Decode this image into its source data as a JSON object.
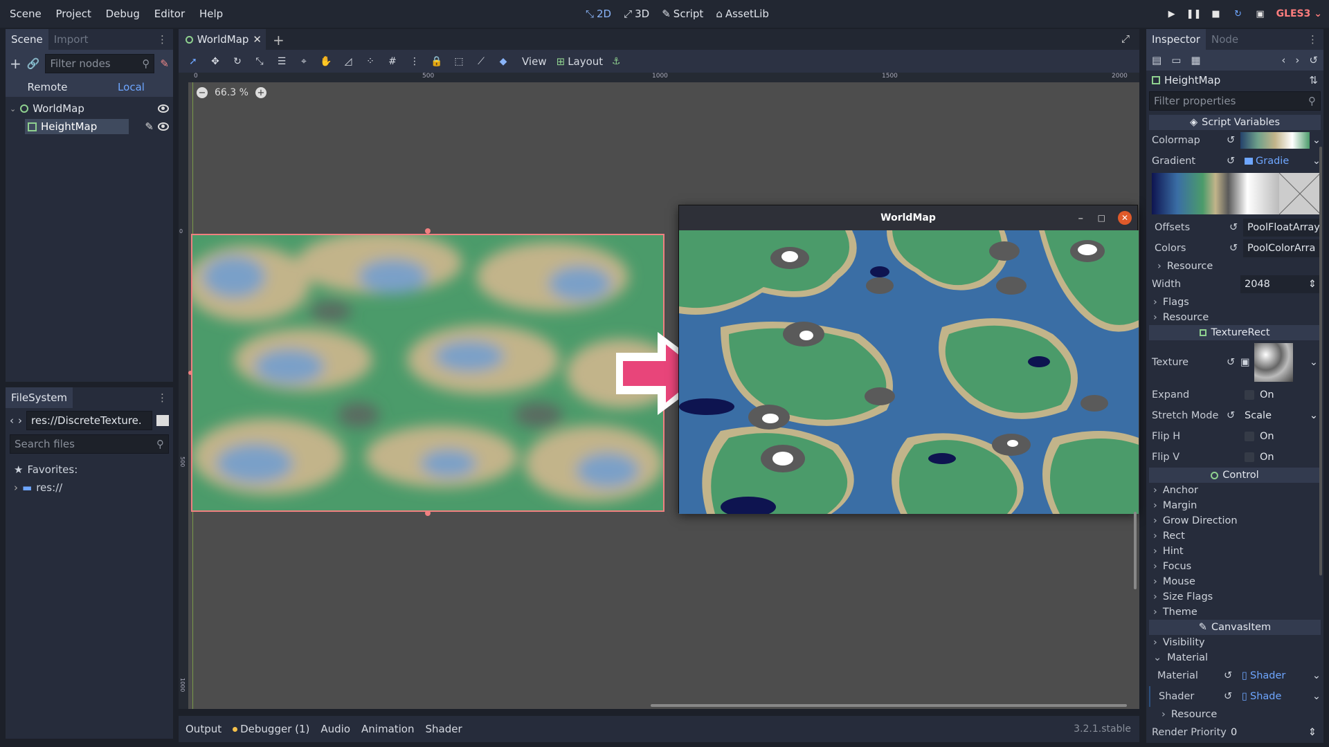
{
  "menu": [
    "Scene",
    "Project",
    "Debug",
    "Editor",
    "Help"
  ],
  "modes": [
    {
      "label": "2D",
      "active": true
    },
    {
      "label": "3D"
    },
    {
      "label": "Script"
    },
    {
      "label": "AssetLib"
    }
  ],
  "renderer": "GLES3",
  "scene_panel": {
    "tabs": [
      "Scene",
      "Import"
    ],
    "filter_placeholder": "Filter nodes",
    "remote_label": "Remote",
    "local_label": "Local",
    "tree": [
      {
        "name": "WorldMap"
      },
      {
        "name": "HeightMap"
      }
    ]
  },
  "filesystem_panel": {
    "tab": "FileSystem",
    "path": "res://DiscreteTexture.",
    "search_placeholder": "Search files",
    "favorites_label": "Favorites:",
    "res_label": "res://"
  },
  "editor": {
    "tab_label": "WorldMap",
    "zoom": "66.3 %",
    "view_label": "View",
    "layout_label": "Layout",
    "ruler_marks": [
      "0",
      "500",
      "1000",
      "1500",
      "2000"
    ],
    "ruler_v_marks": [
      "0",
      "500",
      "1000"
    ]
  },
  "game_window": {
    "title": "WorldMap"
  },
  "inspector": {
    "tabs": [
      "Inspector",
      "Node"
    ],
    "node_name": "HeightMap",
    "filter_placeholder": "Filter properties",
    "script_variables": "Script Variables",
    "colormap_label": "Colormap",
    "gradient_label": "Gradient",
    "gradient_value": "Gradie",
    "offsets_label": "Offsets",
    "offsets_value": "PoolFloatArray",
    "colors_label": "Colors",
    "colors_value": "PoolColorArra",
    "resource_label": "Resource",
    "width_label": "Width",
    "width_value": "2048",
    "flags_label": "Flags",
    "texturerect_label": "TextureRect",
    "texture_label": "Texture",
    "expand_label": "Expand",
    "on_label": "On",
    "stretch_label": "Stretch Mode",
    "stretch_value": "Scale",
    "fliph_label": "Flip H",
    "flipv_label": "Flip V",
    "control_label": "Control",
    "control_items": [
      "Anchor",
      "Margin",
      "Grow Direction",
      "Rect",
      "Hint",
      "Focus",
      "Mouse",
      "Size Flags",
      "Theme"
    ],
    "canvasitem_label": "CanvasItem",
    "visibility_label": "Visibility",
    "material_section_label": "Material",
    "material_label": "Material",
    "material_value": "Shader",
    "shader_label": "Shader",
    "shader_value": "Shade",
    "render_priority_label": "Render Priority",
    "render_priority_value": "0"
  },
  "bottom_tabs": [
    "Output",
    "Debugger (1)",
    "Audio",
    "Animation",
    "Shader"
  ],
  "version": "3.2.1.stable",
  "colors": {
    "accent": "#6ea6ff",
    "arrow": "#e8457a",
    "selection": "#f08080",
    "grass": "#4b9b6a",
    "water": "#3a6ea5",
    "deep": "#0e1450",
    "sand": "#c2b48a",
    "rock": "#5a5a5a"
  }
}
